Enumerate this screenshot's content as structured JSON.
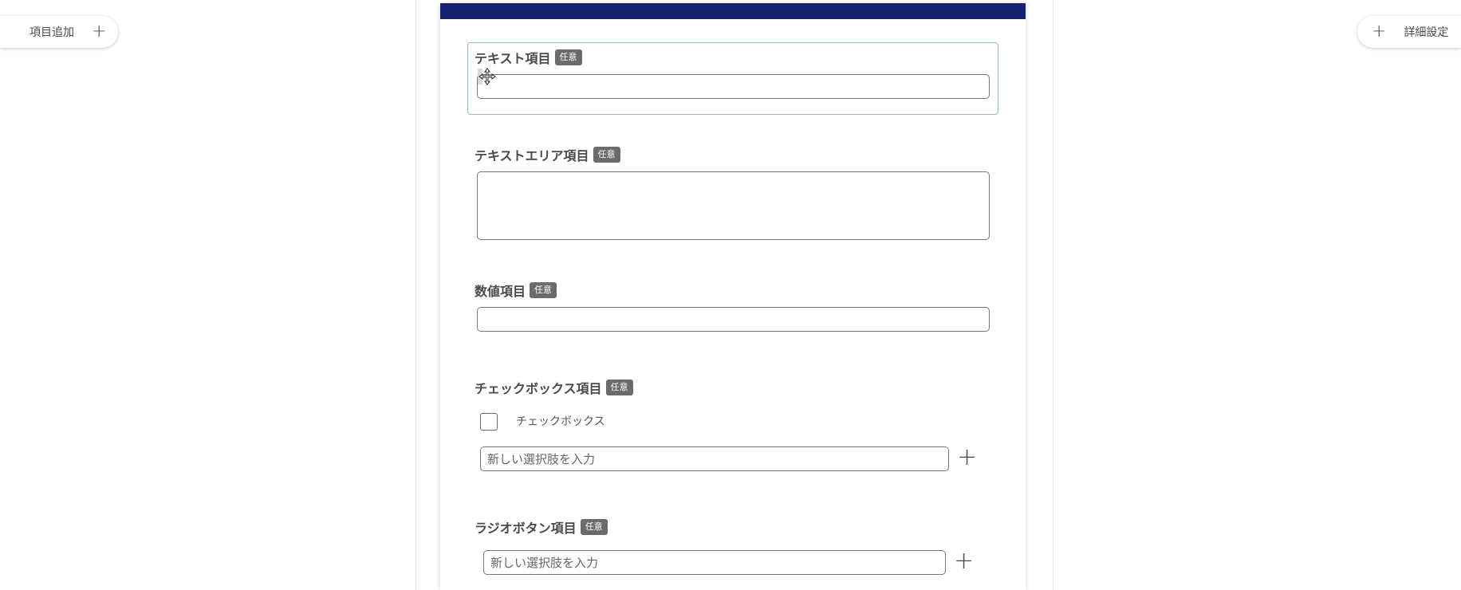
{
  "toolbar": {
    "add_item_label": "項目追加",
    "detail_settings_label": "詳細設定"
  },
  "fields": {
    "text": {
      "label": "テキスト項目",
      "badge": "任意"
    },
    "textarea": {
      "label": "テキストエリア項目",
      "badge": "任意"
    },
    "number": {
      "label": "数値項目",
      "badge": "任意"
    },
    "checkbox": {
      "label": "チェックボックス項目",
      "badge": "任意",
      "option_label": "チェックボックス",
      "new_option_placeholder": "新しい選択肢を入力"
    },
    "radio": {
      "label": "ラジオボタン項目",
      "badge": "任意",
      "new_option_placeholder": "新しい選択肢を入力"
    }
  },
  "colors": {
    "header": "#142170",
    "badge": "#6b6b6b",
    "selected_border": "#8fb9d9"
  }
}
